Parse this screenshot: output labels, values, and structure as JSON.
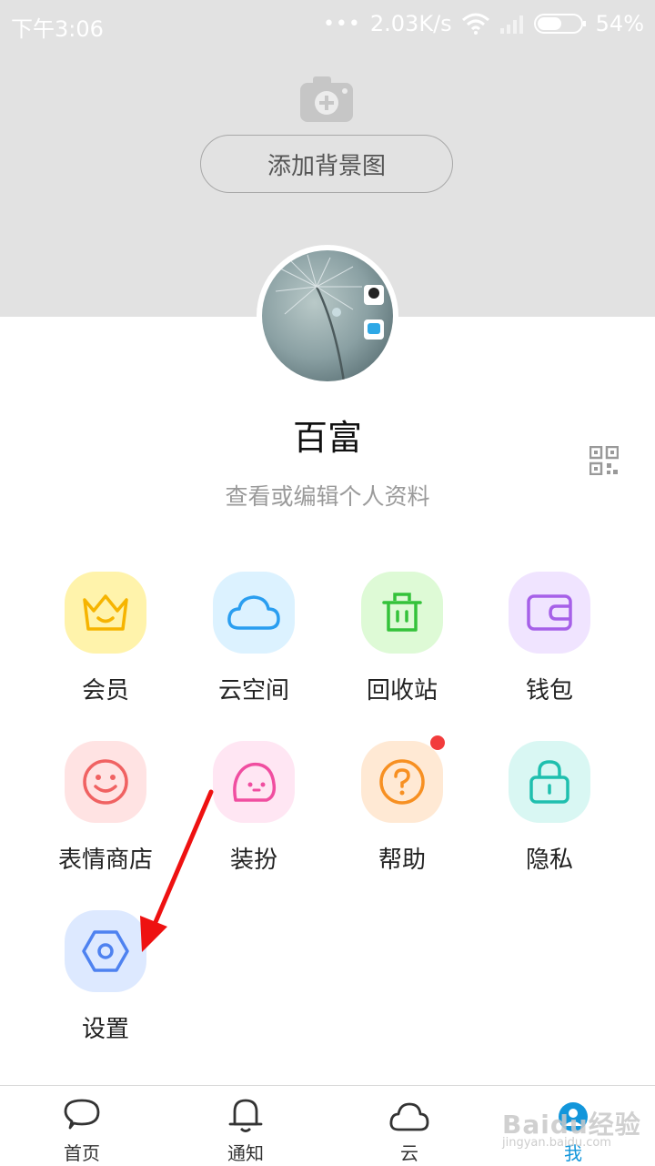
{
  "status_bar": {
    "time": "下午3:06",
    "network_speed": "2.03K/s",
    "battery": "54%"
  },
  "header": {
    "add_background_label": "添加背景图"
  },
  "profile": {
    "name": "百富",
    "edit_link": "查看或编辑个人资料"
  },
  "grid_items": [
    {
      "label": "会员",
      "icon": "crown-icon",
      "bg": "#fff3ab",
      "color": "#f6b400"
    },
    {
      "label": "云空间",
      "icon": "cloud-icon",
      "bg": "#dcf2ff",
      "color": "#2a9ef0"
    },
    {
      "label": "回收站",
      "icon": "trash-icon",
      "bg": "#defad6",
      "color": "#34c23a"
    },
    {
      "label": "钱包",
      "icon": "wallet-icon",
      "bg": "#f0e4ff",
      "color": "#a660e8"
    },
    {
      "label": "表情商店",
      "icon": "smiley-icon",
      "bg": "#ffe3e3",
      "color": "#f06262"
    },
    {
      "label": "装扮",
      "icon": "ghost-icon",
      "bg": "#ffe6f3",
      "color": "#f04ea0"
    },
    {
      "label": "帮助",
      "icon": "help-icon",
      "bg": "#ffe9d4",
      "color": "#f79022"
    },
    {
      "label": "隐私",
      "icon": "lock-icon",
      "bg": "#d9f7f3",
      "color": "#1fbfae"
    },
    {
      "label": "设置",
      "icon": "settings-icon",
      "bg": "#dde9ff",
      "color": "#4e82f0"
    }
  ],
  "bottom_nav": [
    {
      "label": "首页",
      "icon": "chat-icon"
    },
    {
      "label": "通知",
      "icon": "bell-icon"
    },
    {
      "label": "云",
      "icon": "cloud-nav-icon"
    },
    {
      "label": "我",
      "icon": "me-icon",
      "active": true
    }
  ],
  "watermark": {
    "text": "Baidu经验",
    "sub": "jingyan.baidu.com"
  }
}
